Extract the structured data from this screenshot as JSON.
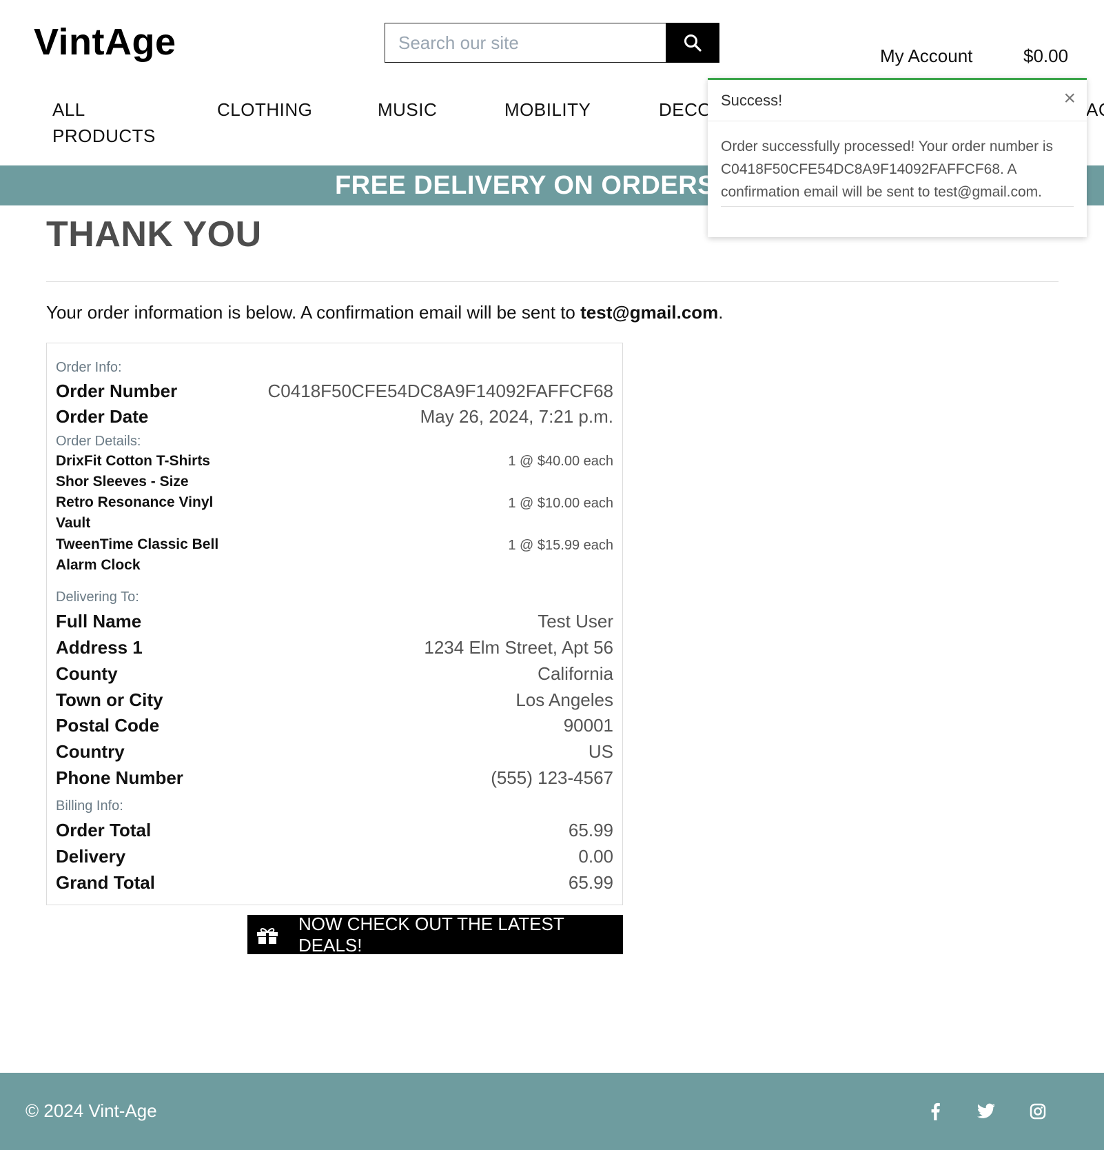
{
  "header": {
    "logo": "VintAge",
    "search_placeholder": "Search our site",
    "my_account": "My Account",
    "cart_total": "$0.00"
  },
  "nav": {
    "all_products_line1": "ALL",
    "all_products_line2": "PRODUCTS",
    "clothing": "CLOTHING",
    "music": "MUSIC",
    "mobility": "MOBILITY",
    "decor": "DECO",
    "truncated": "AC"
  },
  "banner": "FREE DELIVERY ON ORDERS OVI",
  "page": {
    "title": "THANK YOU",
    "intro_text": "Your order information is below. A confirmation email will be sent to ",
    "intro_email": "test@gmail.com",
    "intro_end": "."
  },
  "order_info": {
    "label": "Order Info:",
    "order_number_label": "Order Number",
    "order_number": "C0418F50CFE54DC8A9F14092FAFFCF68",
    "order_date_label": "Order Date",
    "order_date": "May 26, 2024, 7:21 p.m."
  },
  "order_details": {
    "label": "Order Details:",
    "items": [
      {
        "name": "DrixFit Cotton T-Shirts Shor Sleeves - Size",
        "qty": "1 @ $40.00 each"
      },
      {
        "name": "Retro Resonance Vinyl Vault",
        "qty": "1 @ $10.00 each"
      },
      {
        "name": "TweenTime Classic Bell Alarm Clock",
        "qty": "1 @ $15.99 each"
      }
    ]
  },
  "delivery": {
    "label": "Delivering To:",
    "rows": [
      {
        "label": "Full Name",
        "value": "Test User"
      },
      {
        "label": "Address 1",
        "value": "1234 Elm Street, Apt 56"
      },
      {
        "label": "County",
        "value": "California"
      },
      {
        "label": "Town or City",
        "value": "Los Angeles"
      },
      {
        "label": "Postal Code",
        "value": "90001"
      },
      {
        "label": "Country",
        "value": "US"
      },
      {
        "label": "Phone Number",
        "value": "(555) 123-4567"
      }
    ]
  },
  "billing": {
    "label": "Billing Info:",
    "rows": [
      {
        "label": "Order Total",
        "value": "65.99"
      },
      {
        "label": "Delivery",
        "value": "0.00"
      },
      {
        "label": "Grand Total",
        "value": "65.99"
      }
    ]
  },
  "deals_button": "NOW CHECK OUT THE LATEST DEALS!",
  "toast": {
    "title": "Success!",
    "close": "×",
    "message": "Order successfully processed! Your order number is C0418F50CFE54DC8A9F14092FAFFCF68. A confirmation email will be sent to test@gmail.com.",
    "accent_color": "#3aa54a"
  },
  "footer": {
    "copyright": "© 2024 Vint-Age",
    "social_icons": [
      "facebook-icon",
      "twitter-icon",
      "instagram-icon"
    ]
  },
  "colors": {
    "brand_teal": "#6e9c9f",
    "button_black": "#000000"
  }
}
